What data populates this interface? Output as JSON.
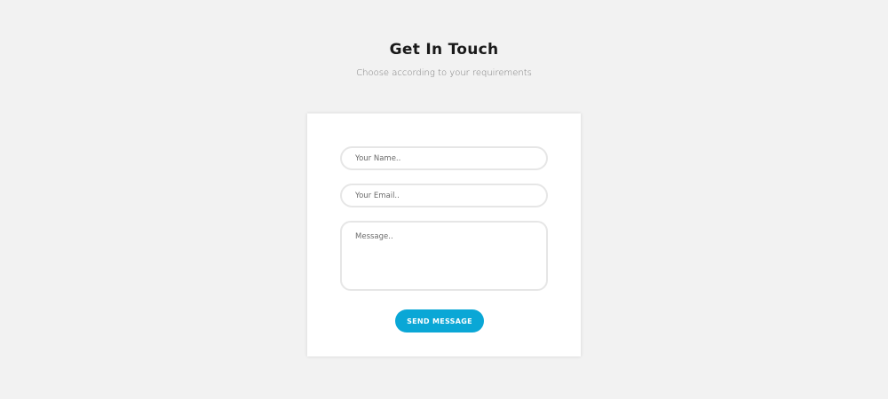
{
  "header": {
    "title": "Get In Touch",
    "subtitle": "Choose according to your requirements"
  },
  "form": {
    "name_placeholder": "Your Name..",
    "email_placeholder": "Your Email..",
    "message_placeholder": "Message..",
    "submit_label": "SEND MESSAGE"
  },
  "colors": {
    "background": "#f2f2f2",
    "card": "#ffffff",
    "accent": "#0aa7d6",
    "field_border": "#e6e6e6"
  }
}
